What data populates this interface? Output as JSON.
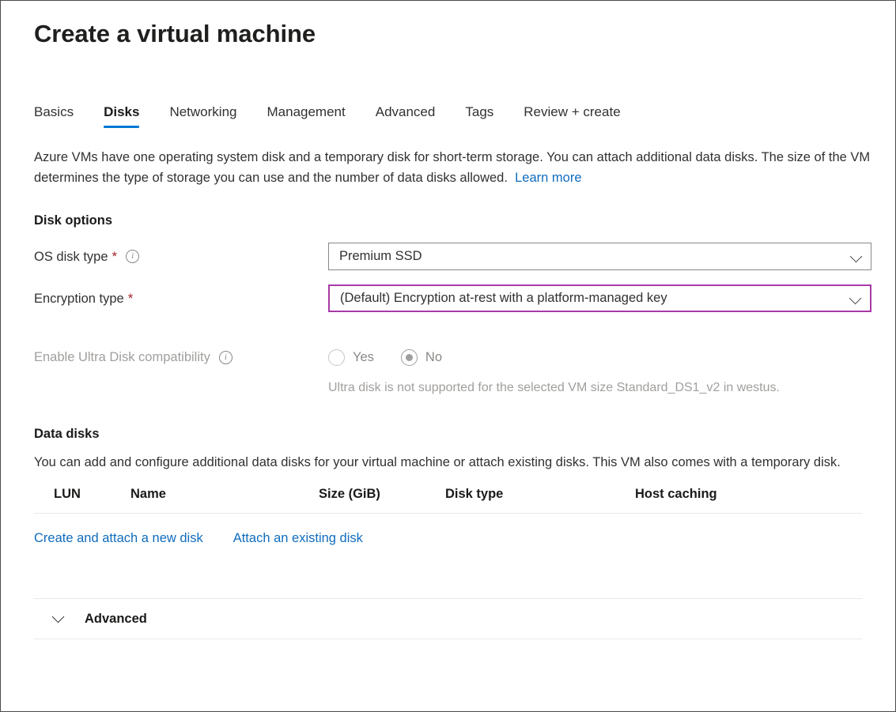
{
  "page": {
    "title": "Create a virtual machine"
  },
  "tabs": [
    {
      "label": "Basics",
      "active": false
    },
    {
      "label": "Disks",
      "active": true
    },
    {
      "label": "Networking",
      "active": false
    },
    {
      "label": "Management",
      "active": false
    },
    {
      "label": "Advanced",
      "active": false
    },
    {
      "label": "Tags",
      "active": false
    },
    {
      "label": "Review + create",
      "active": false
    }
  ],
  "intro": {
    "text": "Azure VMs have one operating system disk and a temporary disk for short-term storage. You can attach additional data disks. The size of the VM determines the type of storage you can use and the number of data disks allowed.",
    "learn_more_label": "Learn more"
  },
  "disk_options": {
    "heading": "Disk options",
    "os_disk_type": {
      "label": "OS disk type",
      "required_marker": "*",
      "info_icon": "info-icon",
      "value": "Premium SSD",
      "chevron_icon": "chevron-down-icon"
    },
    "encryption_type": {
      "label": "Encryption type",
      "required_marker": "*",
      "value": "(Default) Encryption at-rest with a platform-managed key",
      "chevron_icon": "chevron-down-icon",
      "focus_border_color": "#a63aa6"
    },
    "ultra_disk": {
      "label": "Enable Ultra Disk compatibility",
      "info_icon": "info-icon",
      "options": [
        {
          "label": "Yes",
          "checked": false
        },
        {
          "label": "No",
          "checked": true
        }
      ],
      "helper_text": "Ultra disk is not supported for the selected VM size Standard_DS1_v2 in westus."
    }
  },
  "data_disks": {
    "heading": "Data disks",
    "description": "You can add and configure additional data disks for your virtual machine or attach existing disks. This VM also comes with a temporary disk.",
    "columns": [
      "LUN",
      "Name",
      "Size (GiB)",
      "Disk type",
      "Host caching"
    ],
    "rows": [],
    "actions": [
      {
        "label": "Create and attach a new disk"
      },
      {
        "label": "Attach an existing disk"
      }
    ]
  },
  "advanced_section": {
    "title": "Advanced",
    "chevron_icon": "chevron-down-icon",
    "expanded": false
  },
  "colors": {
    "accent": "#0078d4",
    "link": "#0f6cbd",
    "required": "#a4262c",
    "focus_purple": "#a63aa6"
  }
}
